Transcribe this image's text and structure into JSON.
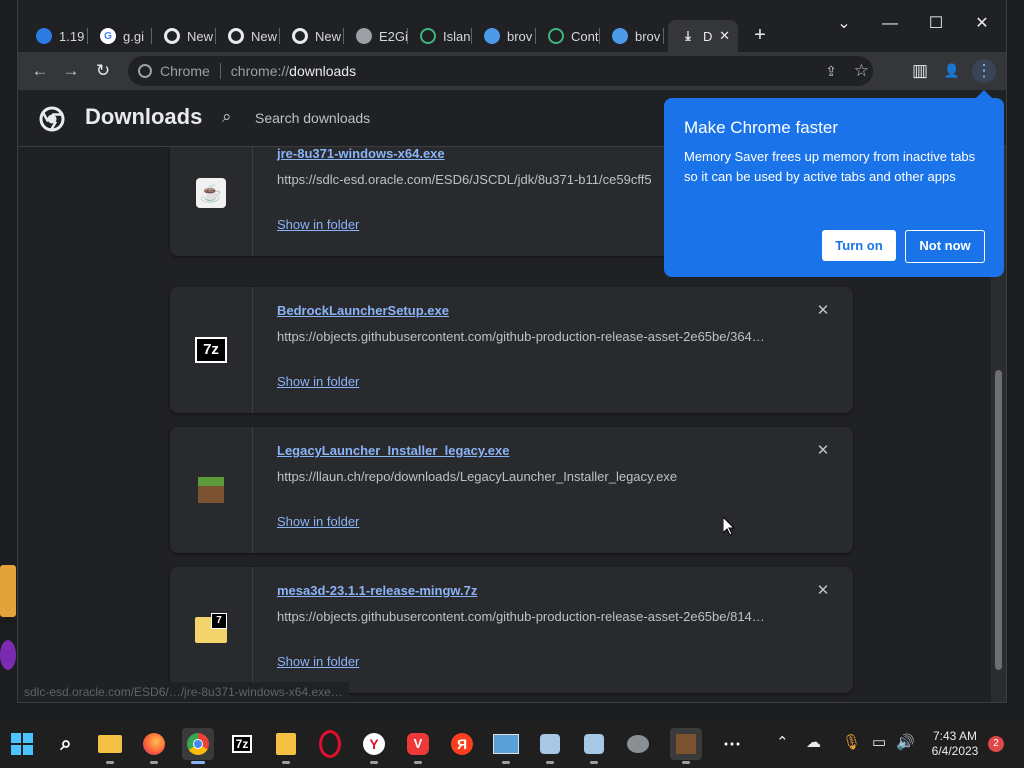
{
  "window": {
    "tabs": [
      {
        "label": "1.19",
        "icon": "earth-icon",
        "color": "#4c8bf5"
      },
      {
        "label": "g.gi",
        "icon": "google-icon",
        "color": "#ffffff"
      },
      {
        "label": "New",
        "icon": "chrome-icon",
        "color": "#e8eaed"
      },
      {
        "label": "New",
        "icon": "chrome-icon",
        "color": "#e8eaed"
      },
      {
        "label": "New",
        "icon": "chrome-icon",
        "color": "#e8eaed"
      },
      {
        "label": "E2Gi",
        "icon": "globe-icon",
        "color": "#9aa0a6"
      },
      {
        "label": "Islan",
        "icon": "green-circle-icon",
        "color": "#3fb27f"
      },
      {
        "label": "brov",
        "icon": "edge-icon",
        "color": "#4c9ae8"
      },
      {
        "label": "Cont",
        "icon": "green-circle-icon",
        "color": "#3fb27f"
      },
      {
        "label": "brov",
        "icon": "edge-icon",
        "color": "#4c9ae8"
      },
      {
        "label": "D",
        "icon": "download-icon",
        "color": "#e8eaed",
        "active": true
      }
    ],
    "new_tab": "+",
    "controls": {
      "tab_search": "⌄",
      "minimize": "—",
      "maximize": "☐",
      "close": "✕"
    }
  },
  "toolbar": {
    "back": "←",
    "forward": "→",
    "reload": "↻",
    "omnibox": {
      "chip": "Chrome",
      "scheme": "chrome://",
      "path": "downloads"
    },
    "share": "⇪",
    "bookmark": "☆",
    "side_panel": "▥",
    "profile": "👤",
    "menu": "⋮"
  },
  "page": {
    "title": "Downloads",
    "search_placeholder": "Search downloads",
    "downloads": [
      {
        "filename": "jre-8u371-windows-x64.exe",
        "url": "https://sdlc-esd.oracle.com/ESD6/JSCDL/jdk/8u371-b11/ce59cff5",
        "action": "Show in folder",
        "icon": "java-icon"
      },
      {
        "filename": "BedrockLauncherSetup.exe",
        "url": "https://objects.githubusercontent.com/github-production-release-asset-2e65be/364…",
        "action": "Show in folder",
        "remove": "✕",
        "icon": "7zip-icon"
      },
      {
        "filename": "LegacyLauncher_Installer_legacy.exe",
        "url": "https://llaun.ch/repo/downloads/LegacyLauncher_Installer_legacy.exe",
        "action": "Show in folder",
        "remove": "✕",
        "icon": "grass-block-icon"
      },
      {
        "filename": "mesa3d-23.1.1-release-mingw.7z",
        "url": "https://objects.githubusercontent.com/github-production-release-asset-2e65be/814…",
        "action": "Show in folder",
        "remove": "✕",
        "icon": "7z-folder-icon"
      }
    ],
    "status_url": "sdlc-esd.oracle.com/ESD6/…/jre-8u371-windows-x64.exe…"
  },
  "bubble": {
    "title": "Make Chrome faster",
    "body": "Memory Saver frees up memory from inactive tabs so it can be used by active tabs and other apps",
    "primary": "Turn on",
    "secondary": "Not now"
  },
  "taskbar": {
    "apps": [
      "start-icon",
      "search-icon",
      "file-explorer-icon",
      "firefox-icon",
      "chrome-icon",
      "7zip-icon",
      "files-icon",
      "opera-icon",
      "yandex-icon",
      "vivaldi-icon",
      "yandex-browser-icon",
      "monitor-icon",
      "app-icon",
      "app-icon-2",
      "raccoon-icon",
      "minecraft-icon"
    ],
    "clock_time": "7:43 AM",
    "clock_date": "6/4/2023",
    "notifications": "2",
    "overflow": "⋯"
  },
  "colors": {
    "accent": "#1a73e8",
    "link": "#8ab4f8",
    "page_bg": "#202124",
    "card_bg": "#292a2d"
  }
}
